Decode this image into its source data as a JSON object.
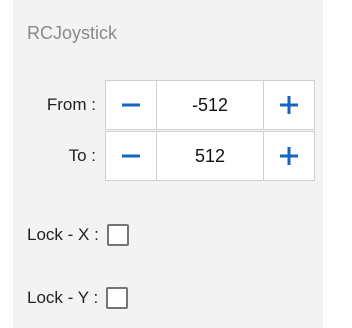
{
  "panel": {
    "title": "RCJoystick"
  },
  "from": {
    "label": "From :",
    "value": "-512",
    "minus_icon": "minus-icon",
    "plus_icon": "plus-icon"
  },
  "to": {
    "label": "To :",
    "value": "512",
    "minus_icon": "minus-icon",
    "plus_icon": "plus-icon"
  },
  "lock_x": {
    "label": "Lock - X :",
    "checked": false
  },
  "lock_y": {
    "label": "Lock - Y :",
    "checked": false
  },
  "colors": {
    "accent": "#1565c0",
    "panel_bg": "#f3f3f3",
    "title": "#8a8a8a"
  }
}
